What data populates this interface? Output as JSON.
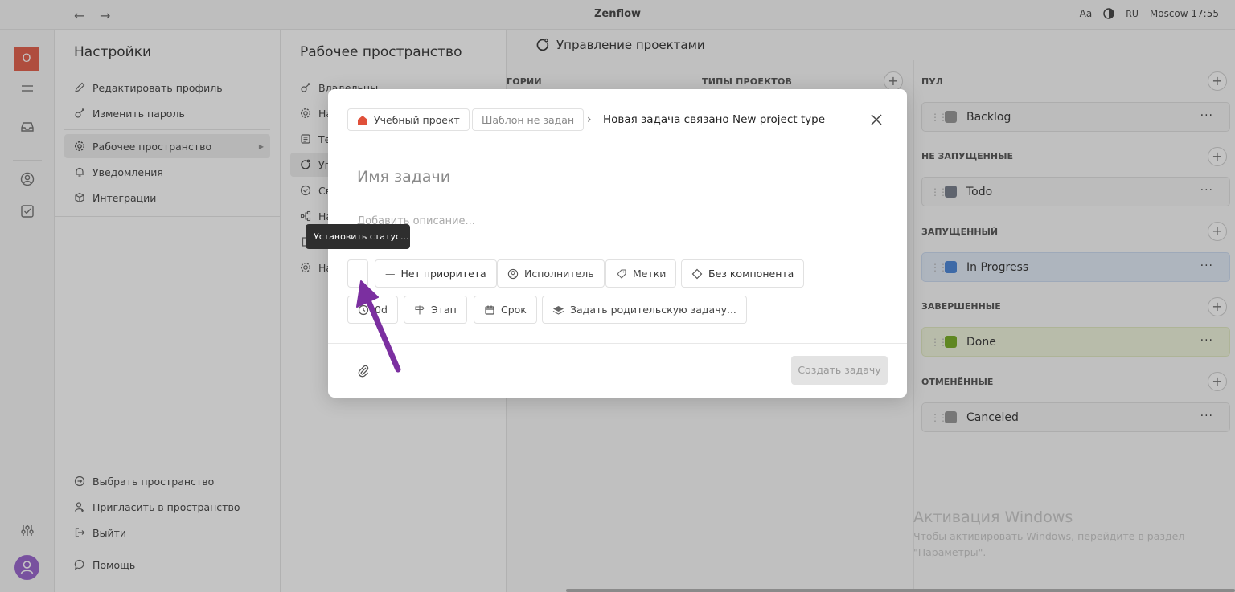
{
  "topbar": {
    "back_icon": "arrow-left-icon",
    "forward_icon": "arrow-right-icon",
    "title": "Zenflow",
    "font_toggle": "Aa",
    "theme_icon": "contrast-icon",
    "lang": "RU",
    "clock": "Moscow 17:55"
  },
  "rail": {
    "workspace_letter": "O",
    "icons": [
      "menu-icon",
      "inbox-icon",
      "user-circle-icon",
      "checkbox-icon",
      "sliders-icon",
      "avatar"
    ]
  },
  "settings": {
    "title": "Настройки",
    "items": [
      {
        "label": "Редактировать профиль",
        "icon": "pencil-icon"
      },
      {
        "label": "Изменить пароль",
        "icon": "key-icon"
      },
      {
        "label": "Рабочее пространство",
        "icon": "gear-icon"
      },
      {
        "label": "Уведомления",
        "icon": "bell-icon"
      },
      {
        "label": "Интеграции",
        "icon": "cube-icon"
      }
    ],
    "bottom_items": [
      {
        "label": "Выбрать пространство",
        "icon": "switch-icon"
      },
      {
        "label": "Пригласить в пространство",
        "icon": "user-plus-icon"
      },
      {
        "label": "Выйти",
        "icon": "logout-icon"
      },
      {
        "label": "Помощь",
        "icon": "chat-icon"
      }
    ]
  },
  "workspace": {
    "title": "Рабочее пространство",
    "items": [
      {
        "label": "Владельцы",
        "icon": "key-icon"
      },
      {
        "label": "На",
        "icon": "gear-icon"
      },
      {
        "label": "Те",
        "icon": "template-icon"
      },
      {
        "label": "Уп",
        "icon": "cycle-icon"
      },
      {
        "label": "Св",
        "icon": "check-circle-icon"
      },
      {
        "label": "На",
        "icon": "hierarchy-icon"
      },
      {
        "label": "",
        "icon": "document-icon"
      },
      {
        "label": "На",
        "icon": "gear-icon"
      }
    ]
  },
  "main": {
    "title": "Управление проектами",
    "col1_head": "ГОРИИ",
    "col2_head": "ТИПЫ ПРОЕКТОВ",
    "states": [
      {
        "group": "ПУЛ",
        "name": "Backlog",
        "color": "#8e8e8e"
      },
      {
        "group": "НЕ ЗАПУЩЕННЫЕ",
        "name": "Todo",
        "color": "#6b7280"
      },
      {
        "group": "ЗАПУЩЕННЫЙ",
        "name": "In Progress",
        "color": "#3a7bd5"
      },
      {
        "group": "ЗАВЕРШЕННЫЕ",
        "name": "Done",
        "color": "#6aa510"
      },
      {
        "group": "ОТМЕНЁННЫЕ",
        "name": "Canceled",
        "color": "#8e8e8e"
      }
    ],
    "watermark_title": "Активация Windows",
    "watermark_line1": "Чтобы активировать Windows, перейдите в раздел",
    "watermark_line2": "\"Параметры\"."
  },
  "modal": {
    "project": "Учебный проект",
    "project_color": "#e0503a",
    "template": "Шаблон не задан",
    "breadcrumb_sep": "›",
    "breadcrumb": "Новая задача связано New project type",
    "task_name_placeholder": "Имя задачи",
    "description_placeholder": "Добавить описание...",
    "priority": "Нет приоритета",
    "assignee": "Исполнитель",
    "labels": "Метки",
    "component": "Без компонента",
    "estimate": "0d",
    "stage": "Этап",
    "due": "Срок",
    "parent": "Задать родительскую задачу...",
    "create_button": "Создать задачу"
  },
  "tooltip": "Установить статус...",
  "annotation": {
    "arrow_color": "#7b2fa0"
  }
}
